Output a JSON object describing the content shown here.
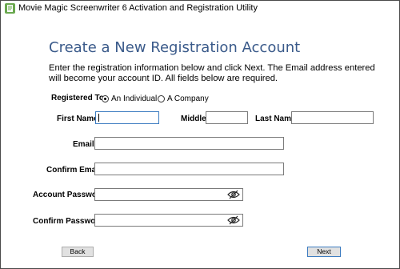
{
  "window": {
    "title": "Movie Magic Screenwriter 6 Activation and Registration Utility"
  },
  "page": {
    "heading": "Create a New Registration Account",
    "intro_line1": "Enter the registration information below and click Next.  The Email address entered",
    "intro_line2": "will become your account ID.  All fields below are required."
  },
  "form": {
    "registered_to_label": "Registered To:",
    "option_individual": "An Individual",
    "option_company": "A Company",
    "registered_to_selected": "An Individual",
    "first_name_label": "First Name",
    "first_name_value": "",
    "middle_label": "Middle",
    "middle_value": "",
    "last_name_label": "Last Name",
    "last_name_value": "",
    "email_label": "Email",
    "email_value": "",
    "confirm_email_label": "Confirm Email",
    "confirm_email_value": "",
    "account_password_label": "Account Password",
    "account_password_value": "",
    "confirm_password_label": "Confirm Password",
    "confirm_password_value": ""
  },
  "buttons": {
    "back": "Back",
    "next": "Next"
  },
  "icons": {
    "app": "app-icon",
    "password_toggle": "eye-slash-icon"
  }
}
